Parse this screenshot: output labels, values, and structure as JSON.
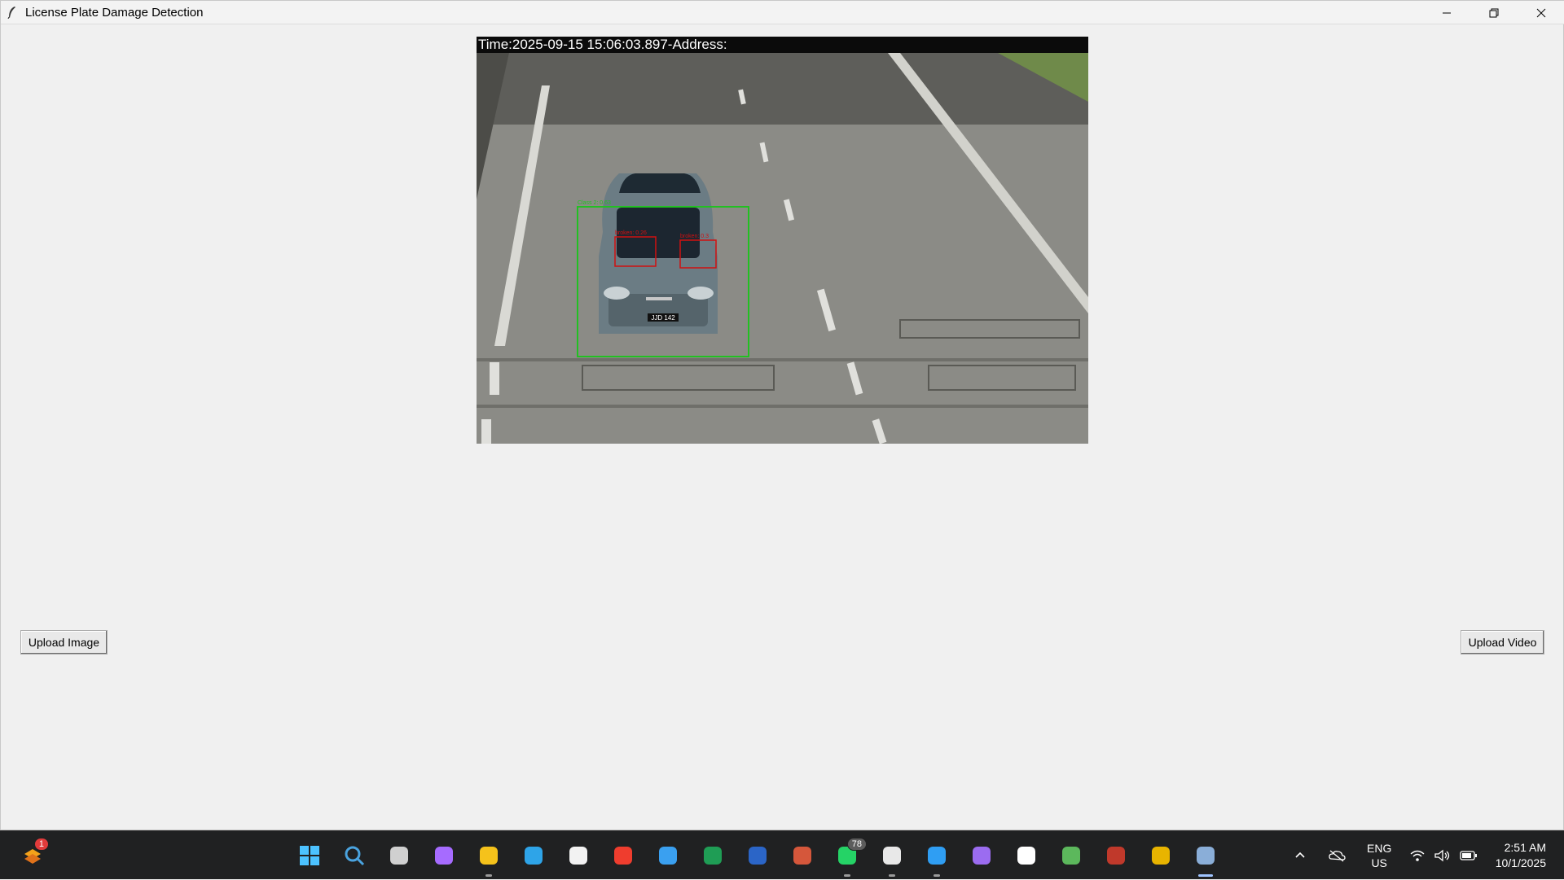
{
  "window": {
    "title": "License Plate Damage Detection",
    "controls": [
      "minimize-icon",
      "restore-icon",
      "close-icon"
    ]
  },
  "video": {
    "overlay_text": "Time:2025-09-15 15:06:03.897-Address:",
    "detections": [
      {
        "label": "Class 2: 0.63",
        "color": "#00cc00"
      },
      {
        "label": "broken: 0.26",
        "color": "#e00000"
      },
      {
        "label": "broken: 0.3",
        "color": "#e00000"
      }
    ],
    "plate_text": "JJD 142"
  },
  "buttons": {
    "upload_image": "Upload Image",
    "upload_video": "Upload Video"
  },
  "taskbar": {
    "apps": [
      {
        "name": "start-icon",
        "color": "#4cc2ff"
      },
      {
        "name": "search-icon",
        "color": "#4aa3df"
      },
      {
        "name": "task-view-icon",
        "color": "#d0d0d0"
      },
      {
        "name": "copilot-icon",
        "color": "#a66bff"
      },
      {
        "name": "file-explorer-icon",
        "color": "#f5c21b",
        "running": true
      },
      {
        "name": "edge-icon",
        "color": "#2ea4e8"
      },
      {
        "name": "store-icon",
        "color": "#f2f2f2"
      },
      {
        "name": "anydesk-icon",
        "color": "#ef3d2e"
      },
      {
        "name": "help-icon",
        "color": "#3aa0f0"
      },
      {
        "name": "excel-icon",
        "color": "#1f9d55"
      },
      {
        "name": "word-icon",
        "color": "#2b65c7"
      },
      {
        "name": "powerpoint-icon",
        "color": "#d5573b"
      },
      {
        "name": "whatsapp-icon",
        "color": "#25d366",
        "badge": "78",
        "running": true
      },
      {
        "name": "chatgpt-icon",
        "color": "#e8e8e8",
        "running": true
      },
      {
        "name": "vscode-icon",
        "color": "#2f9ef3",
        "running": true
      },
      {
        "name": "github-icon",
        "color": "#9b6cf0"
      },
      {
        "name": "capcut-icon",
        "color": "#ffffff"
      },
      {
        "name": "git-icon",
        "color": "#5cb85c"
      },
      {
        "name": "access-icon",
        "color": "#c0392b"
      },
      {
        "name": "chrome-icon",
        "color": "#e8b400"
      },
      {
        "name": "python-tk-icon",
        "color": "#8aaed8",
        "active": true
      }
    ],
    "widget_badge": "1",
    "language": "ENG",
    "region": "US",
    "time": "2:51 AM",
    "date": "10/1/2025"
  }
}
